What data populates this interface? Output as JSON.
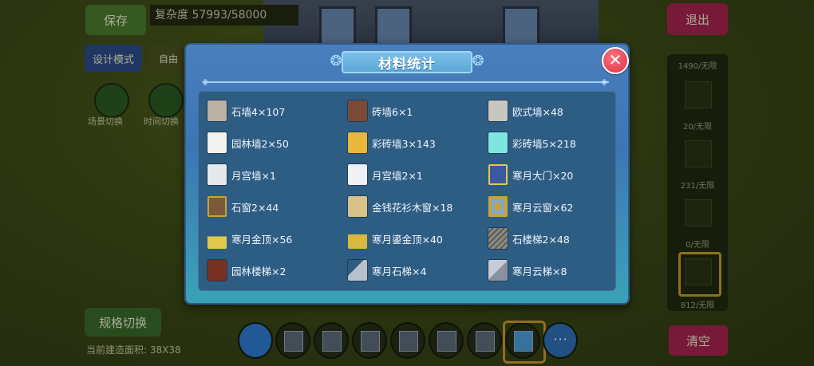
{
  "background": {
    "save_label": "保存",
    "complexity_label": "复杂度 57993/58000",
    "design_mode_label": "设计模式",
    "free_label": "自由",
    "scene_switch_label": "场景切换",
    "time_switch_label": "时间切换",
    "exit_label": "退出",
    "spec_switch_label": "规格切换",
    "area_label": "当前建造面积: 38X38",
    "clear_label": "清空",
    "right_panel_labels": [
      "1490/无限",
      "20/无限",
      "231/无限",
      "0/无限",
      "812/无限"
    ]
  },
  "modal": {
    "title": "材料统计",
    "close_icon": "close-icon",
    "items": [
      {
        "label": "石墙4×107",
        "icon": "stone-wall-icon",
        "color": "#b9b2a4"
      },
      {
        "label": "砖墙6×1",
        "icon": "brick-wall-icon",
        "color": "#7a4a36"
      },
      {
        "label": "欧式墙×48",
        "icon": "european-wall-icon",
        "color": "#c9c6c0"
      },
      {
        "label": "园林墙2×50",
        "icon": "garden-wall-icon",
        "color": "#f2f2ee"
      },
      {
        "label": "彩砖墙3×143",
        "icon": "color-brick-wall-icon",
        "color": "#e8b83a"
      },
      {
        "label": "彩砖墙5×218",
        "icon": "color-brick-wall-icon",
        "color": "#7ee6de"
      },
      {
        "label": "月宫墙×1",
        "icon": "moon-palace-wall-icon",
        "color": "#e6e8ec"
      },
      {
        "label": "月宫墙2×1",
        "icon": "moon-palace-wall-icon",
        "color": "#eef0f4"
      },
      {
        "label": "寒月大门×20",
        "icon": "cold-moon-gate-icon",
        "color": "#3b5a9e"
      },
      {
        "label": "石窗2×44",
        "icon": "stone-window-icon",
        "color": "#7a5a3a"
      },
      {
        "label": "金钱花衫木窗×18",
        "icon": "wood-window-icon",
        "color": "#d8c28a"
      },
      {
        "label": "寒月云窗×62",
        "icon": "cloud-window-icon",
        "color": "#c9a23a"
      },
      {
        "label": "寒月金顶×56",
        "icon": "gold-roof-icon",
        "color": "#e2c84e"
      },
      {
        "label": "寒月鎏金顶×40",
        "icon": "gilded-roof-icon",
        "color": "#d8b840"
      },
      {
        "label": "石楼梯2×48",
        "icon": "stone-stairs-icon",
        "color": "#8c8a84"
      },
      {
        "label": "园林楼梯×2",
        "icon": "garden-stairs-icon",
        "color": "#7a3020"
      },
      {
        "label": "寒月石梯×4",
        "icon": "stone-ladder-icon",
        "color": "#b8c0cc"
      },
      {
        "label": "寒月云梯×8",
        "icon": "cloud-ladder-icon",
        "color": "#c8ccd6"
      }
    ]
  },
  "colors": {
    "modal_top": "#4a7ebc",
    "modal_bottom": "#3aa3b6",
    "panel": "#2e5d84",
    "close": "#d8344a",
    "title_bar": "#6ab2e0"
  }
}
